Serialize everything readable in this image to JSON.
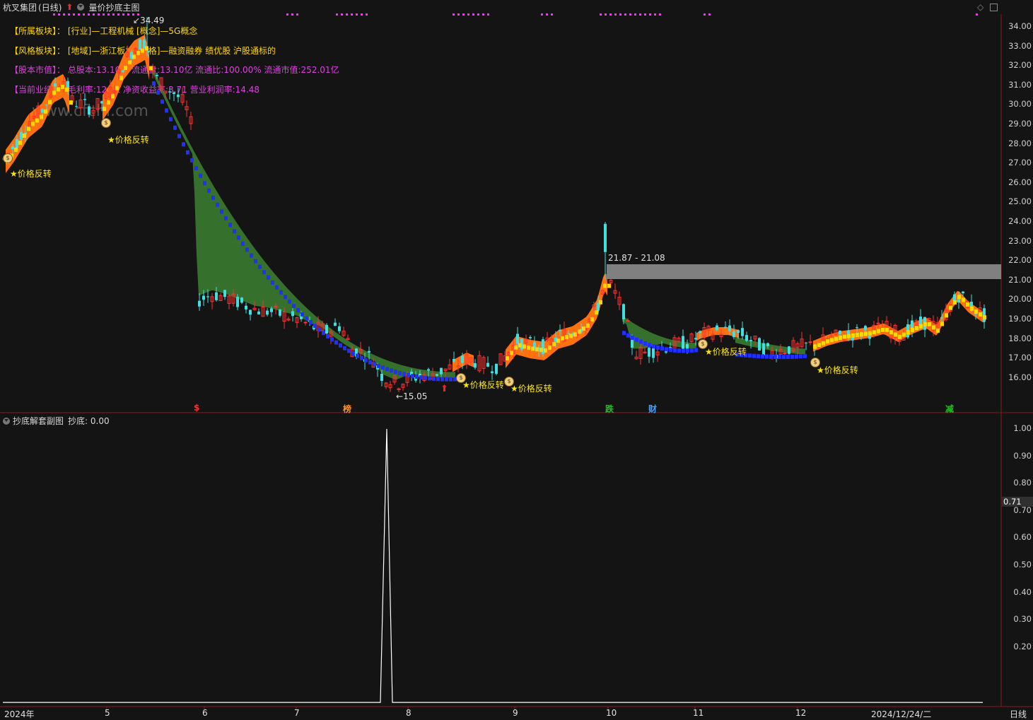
{
  "header": {
    "stock_name": "杭叉集团",
    "period": "(日线)",
    "indicator_name": "量价抄底主图"
  },
  "info_lines": [
    {
      "label": "【所属板块】：",
      "text": "[行业]—工程机械 [概念]—5G概念",
      "color": "#ffd800"
    },
    {
      "label": "【风格板块】：",
      "text": "[地域]—浙江板块 [风格]—融资融券 绩优股 沪股通标的",
      "color": "#ffd800"
    },
    {
      "label": "【股本市值】：",
      "text": "总股本:13.10亿 流通盘:13.10亿 流通比:100.00% 流通市值:252.01亿",
      "color": "#e040e0"
    },
    {
      "label": "【当前业绩】：",
      "text": "毛利率:12.02 净资收益率:3.71 营业利润率:14.48",
      "color": "#e040e0"
    }
  ],
  "watermark": "www.cfchi.com",
  "main_chart": {
    "y_axis_labels": [
      "34.00",
      "33.00",
      "32.00",
      "31.00",
      "30.00",
      "29.00",
      "28.00",
      "27.00",
      "26.00",
      "25.00",
      "24.00",
      "23.00",
      "22.00",
      "21.00",
      "20.00",
      "19.00",
      "18.00",
      "17.00",
      "16.00"
    ],
    "high_label": "34.49",
    "low_label": "15.05",
    "range_box_label": "21.87 - 21.08",
    "signal_label": "★价格反转",
    "event_markers": [
      {
        "text": "$",
        "color": "#ff3030"
      },
      {
        "text": "榜",
        "color": "#ff9020"
      },
      {
        "text": "跌",
        "color": "#20c020"
      },
      {
        "text": "财",
        "color": "#40a0ff"
      },
      {
        "text": "减",
        "color": "#20c020"
      }
    ]
  },
  "sub_chart": {
    "title": "抄底解套副图",
    "value_text": "抄底: 0.00",
    "current_value": "0.71",
    "y_axis_labels": [
      "1.00",
      "0.90",
      "0.80",
      "0.70",
      "0.60",
      "0.50",
      "0.40",
      "0.30",
      "0.20"
    ]
  },
  "x_axis": {
    "labels": [
      "2024年",
      "5",
      "6",
      "7",
      "8",
      "9",
      "10",
      "11",
      "12",
      "2024/12/24/二"
    ],
    "period_button": "日线"
  },
  "colors": {
    "up": "#ff3030",
    "down": "#40e0e0",
    "band_orange": "#ff7010",
    "band_green": "#3a7a30",
    "blue_line": "#2030ff",
    "yellow_line": "#ffd800"
  },
  "chart_data": {
    "type": "line",
    "title": "抄底解套副图",
    "series": [
      {
        "name": "抄底",
        "x": [
          "2024年",
          "5",
          "6",
          "7",
          "8",
          "9",
          "10",
          "11",
          "12"
        ],
        "values": [
          0,
          0,
          0,
          0,
          1.0,
          0,
          0,
          0,
          0
        ]
      }
    ],
    "ylim": [
      0,
      1.0
    ]
  }
}
